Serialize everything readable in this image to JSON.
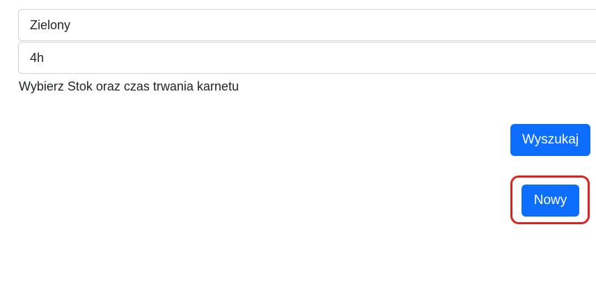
{
  "form": {
    "slope_value": "Zielony",
    "duration_value": "4h",
    "help_text": "Wybierz Stok oraz czas trwania karnetu"
  },
  "buttons": {
    "search_label": "Wyszukaj",
    "new_label": "Nowy"
  },
  "colors": {
    "primary": "#0d6efd",
    "highlight": "#e0201b",
    "border": "#ced4da"
  }
}
